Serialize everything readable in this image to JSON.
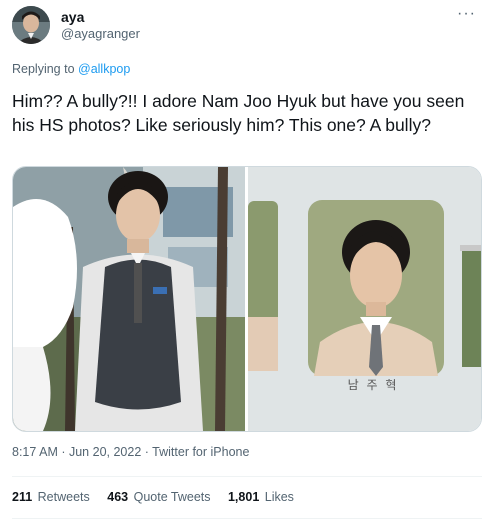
{
  "author": {
    "name": "aya",
    "handle": "@ayagranger"
  },
  "more_icon_glyph": "···",
  "reply": {
    "prefix": "Replying to ",
    "to": "@allkpop"
  },
  "tweet": {
    "text": "Him?? A bully?!! I adore Nam Joo Hyuk but have you seen his HS photos? Like seriously him? This one? A bully?"
  },
  "media": {
    "yearbook_caption": "남 주 혁"
  },
  "meta": {
    "time": "8:17 AM",
    "separator1": " · ",
    "date": "Jun 20, 2022",
    "separator2": " · ",
    "source": "Twitter for iPhone"
  },
  "stats": {
    "retweets_count": "211",
    "retweets_label": "Retweets",
    "quotes_count": "463",
    "quotes_label": "Quote Tweets",
    "likes_count": "1,801",
    "likes_label": "Likes"
  },
  "colors": {
    "link": "#1d9bf0",
    "secondary_text": "#536471",
    "primary_text": "#0f1419",
    "border": "#cfd9de"
  }
}
